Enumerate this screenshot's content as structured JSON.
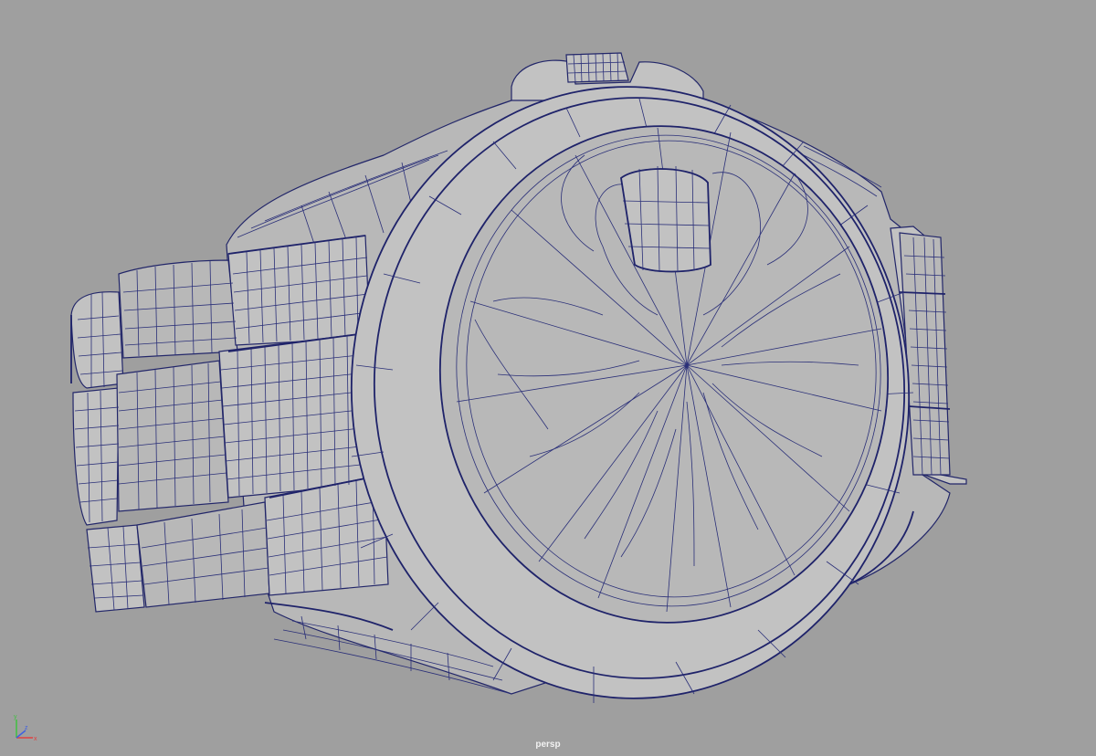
{
  "viewport": {
    "camera_label": "persp",
    "background_color": "#9f9f9f",
    "wireframe_color": "#2a2f78",
    "shaded_color": "#bcbcbc"
  },
  "axis_gizmo": {
    "axes": [
      "y",
      "x",
      "z"
    ],
    "colors": {
      "x": "#e04040",
      "y": "#40c040",
      "z": "#4060e0"
    }
  }
}
